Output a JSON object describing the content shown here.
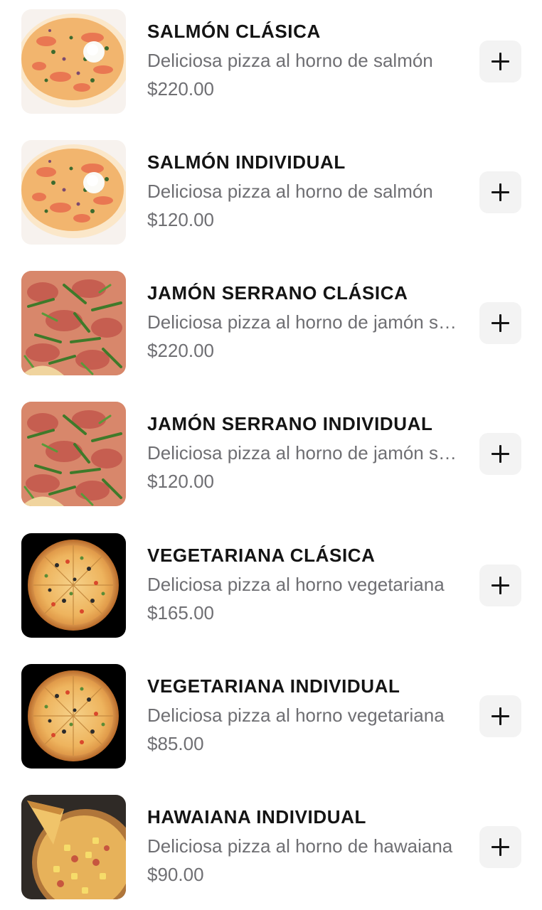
{
  "menu": {
    "items": [
      {
        "name": "SALMÓN CLÁSICA",
        "description": "Deliciosa pizza al horno de salmón",
        "price": "$220.00",
        "image": "salmon-pizza",
        "add_icon": "plus-icon"
      },
      {
        "name": "SALMÓN INDIVIDUAL",
        "description": "Deliciosa pizza al horno de salmón",
        "price": "$120.00",
        "image": "salmon-pizza",
        "add_icon": "plus-icon"
      },
      {
        "name": "JAMÓN SERRANO CLÁSICA",
        "description": "Deliciosa pizza al horno de jamón serrano",
        "price": "$220.00",
        "image": "serrano-pizza",
        "add_icon": "plus-icon"
      },
      {
        "name": "JAMÓN SERRANO INDIVIDUAL",
        "description": "Deliciosa pizza al horno de jamón serrano",
        "price": "$120.00",
        "image": "serrano-pizza",
        "add_icon": "plus-icon"
      },
      {
        "name": "VEGETARIANA CLÁSICA",
        "description": "Deliciosa pizza al horno vegetariana",
        "price": "$165.00",
        "image": "vegetarian-pizza",
        "add_icon": "plus-icon"
      },
      {
        "name": "VEGETARIANA INDIVIDUAL",
        "description": "Deliciosa pizza al horno vegetariana",
        "price": "$85.00",
        "image": "vegetarian-pizza",
        "add_icon": "plus-icon"
      },
      {
        "name": "HAWAIANA INDIVIDUAL",
        "description": "Deliciosa pizza al horno de hawaiana",
        "price": "$90.00",
        "image": "hawaiian-pizza",
        "add_icon": "plus-icon"
      }
    ]
  }
}
